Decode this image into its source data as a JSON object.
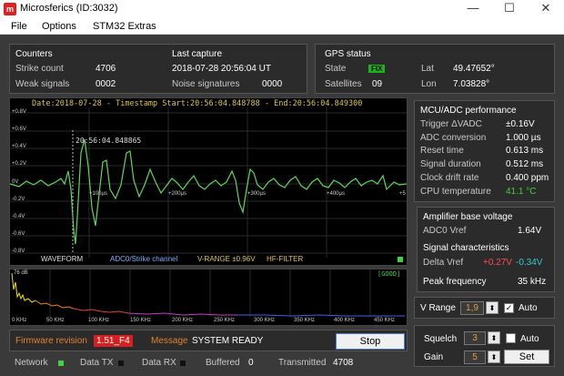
{
  "window": {
    "app_icon": "m",
    "title": "Microsferics (ID:3032)",
    "minimize": "—",
    "maximize": "☐",
    "close": "✕"
  },
  "menu": {
    "items": [
      "File",
      "Options",
      "STM32 Extras"
    ]
  },
  "counters": {
    "title": "Counters",
    "strike_label": "Strike count",
    "strike_value": "4706",
    "weak_label": "Weak signals",
    "weak_value": "0002"
  },
  "capture": {
    "title": "Last capture",
    "timestamp": "2018-07-28 20:56:04 UT",
    "noise_label": "Noise signatures",
    "noise_value": "0000"
  },
  "gps": {
    "title": "GPS status",
    "state_label": "State",
    "state_value": "FIX",
    "sat_label": "Satellites",
    "sat_value": "09",
    "lat_label": "Lat",
    "lat_value": "49.47652°",
    "lon_label": "Lon",
    "lon_value": "7.03828°"
  },
  "scope": {
    "header": "Date:2018-07-28 - Timestamp Start:20:56:04.848788 - End:20:56:04.849300",
    "cursor_time": "20:56:04.848865",
    "y_ticks": [
      "+0.8V",
      "+0.6V",
      "+0.4V",
      "+0.2V",
      "0V",
      "-0.2V",
      "-0.4V",
      "-0.6V",
      "-0.8V"
    ],
    "x_ticks": [
      "+100µs",
      "+200µs",
      "+300µs",
      "+400µs",
      "+5"
    ],
    "footer_waveform": "WAVEFORM",
    "footer_channel": "ADC0/Strike channel",
    "footer_range": "V-RANGE ±0.96V",
    "footer_filter": "HF-FILTER"
  },
  "spectrum": {
    "db_label": "76 dB",
    "status": "[GOOD]",
    "x_ticks": [
      "0 KHz",
      "50 KHz",
      "100 KHz",
      "150 KHz",
      "200 KHz",
      "250 KHz",
      "300 KHz",
      "350 KHz",
      "400 KHz",
      "450 KHz"
    ]
  },
  "mcu": {
    "title": "MCU/ADC performance",
    "rows": [
      {
        "label": "Trigger ΔVADC",
        "value": "±0.16V"
      },
      {
        "label": "ADC conversion",
        "value": "1.000 µs"
      },
      {
        "label": "Reset time",
        "value": "0.613 ms"
      },
      {
        "label": "Signal duration",
        "value": "0.512 ms"
      },
      {
        "label": "Clock drift rate",
        "value": "0.400 ppm"
      },
      {
        "label": "CPU temperature",
        "value": "41.1 °C"
      }
    ]
  },
  "amplifier": {
    "title": "Amplifier base voltage",
    "vref_label": "ADC0 Vref",
    "vref_value": "1.64V",
    "sig_title": "Signal characteristics",
    "delta_label": "Delta Vref",
    "delta_pos": "+0.27V",
    "delta_neg": "-0.34V",
    "peak_label": "Peak frequency",
    "peak_value": "35 kHz"
  },
  "vrange": {
    "label": "V Range",
    "value": "1,9",
    "auto_label": "Auto",
    "auto_checked": true
  },
  "squelch": {
    "label": "Squelch",
    "value": "3",
    "auto_label": "Auto",
    "auto_checked": false
  },
  "gain": {
    "label": "Gain",
    "value": "5",
    "set_label": "Set"
  },
  "firmware": {
    "label": "Firmware revision",
    "value": "1.51_F4"
  },
  "message": {
    "label": "Message",
    "value": "SYSTEM READY"
  },
  "stop_button": "Stop",
  "statusbar": {
    "network": "Network",
    "data_tx": "Data TX",
    "data_rx": "Data RX",
    "buffered_label": "Buffered",
    "buffered_value": "0",
    "transmitted_label": "Transmitted",
    "transmitted_value": "4708"
  }
}
